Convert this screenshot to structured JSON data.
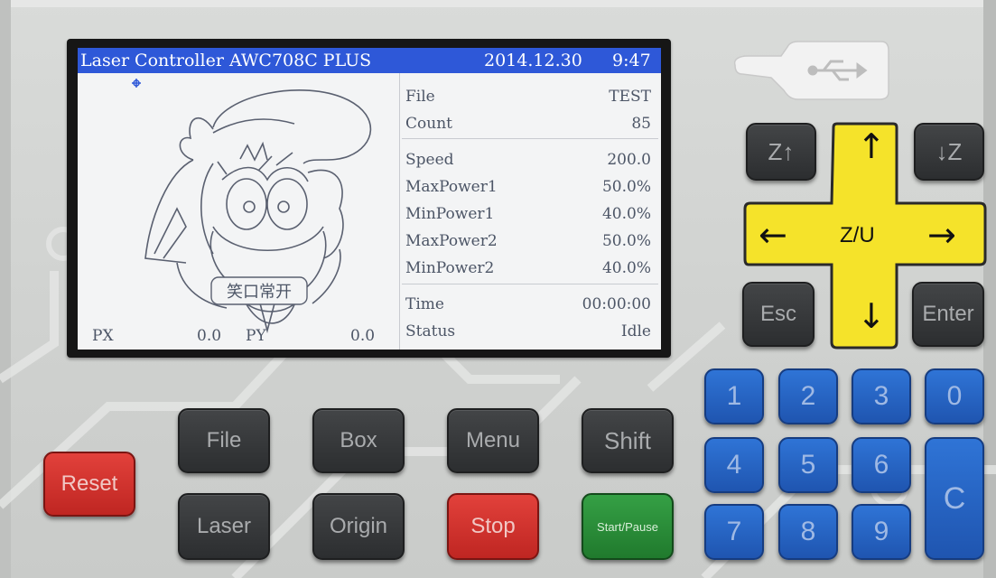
{
  "screen": {
    "title": "Laser Controller AWC708C PLUS",
    "date": "2014.12.30",
    "time": "9:47",
    "drawing_caption": "笑口常开",
    "info_rows": [
      {
        "key": "File",
        "value": "TEST"
      },
      {
        "key": "Count",
        "value": "85"
      },
      {
        "key": "Speed",
        "value": "200.0"
      },
      {
        "key": "MaxPower1",
        "value": "50.0%"
      },
      {
        "key": "MinPower1",
        "value": "40.0%"
      },
      {
        "key": "MaxPower2",
        "value": "50.0%"
      },
      {
        "key": "MinPower2",
        "value": "40.0%"
      },
      {
        "key": "Time",
        "value": "00:00:00"
      },
      {
        "key": "Status",
        "value": "Idle"
      }
    ],
    "px_label": "PX",
    "px_value": "0.0",
    "py_label": "PY",
    "py_value": "0.0",
    "colors": {
      "titlebar": "#2e58d8",
      "lcd_bg": "#f3f4f5",
      "text": "#4c5566"
    }
  },
  "keys": {
    "reset": "Reset",
    "file": "File",
    "box": "Box",
    "menu": "Menu",
    "shift": "Shift",
    "laser": "Laser",
    "origin": "Origin",
    "stop": "Stop",
    "start_pause": "Start/Pause",
    "esc": "Esc",
    "enter": "Enter",
    "z_up": "Z↑",
    "z_down": "↓Z",
    "zu": "Z/U",
    "up": "↑",
    "down": "↓",
    "left": "←",
    "right": "→",
    "c": "C",
    "digits": [
      "1",
      "2",
      "3",
      "0",
      "4",
      "5",
      "6",
      "7",
      "8",
      "9"
    ]
  },
  "icons": [
    "usb-icon",
    "crosshair-icon"
  ],
  "colors": {
    "yellow": "#f5e32a",
    "blue_key": "#2f74d6",
    "red_key": "#d8332e",
    "green_key": "#2c8f3b"
  }
}
